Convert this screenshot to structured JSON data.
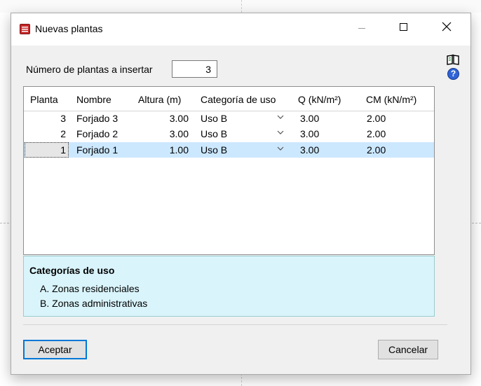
{
  "window": {
    "title": "Nuevas plantas",
    "icons": {
      "app": "app-logo-icon",
      "minimize": "minimize-icon",
      "maximize": "maximize-icon",
      "close": "close-icon"
    }
  },
  "side_icons": {
    "book": "book-icon",
    "help": "help-icon",
    "help_glyph": "?"
  },
  "form": {
    "count_label": "Número de plantas a insertar",
    "count_value": "3"
  },
  "table": {
    "columns": [
      "Planta",
      "Nombre",
      "Altura (m)",
      "Categoría de uso",
      "Q (kN/m²)",
      "CM (kN/m²)"
    ],
    "rows": [
      {
        "planta": "3",
        "nombre": "Forjado 3",
        "altura": "3.00",
        "categoria": "Uso B",
        "q": "3.00",
        "cm": "2.00",
        "selected": false
      },
      {
        "planta": "2",
        "nombre": "Forjado 2",
        "altura": "3.00",
        "categoria": "Uso B",
        "q": "3.00",
        "cm": "2.00",
        "selected": false
      },
      {
        "planta": "1",
        "nombre": "Forjado 1",
        "altura": "1.00",
        "categoria": "Uso B",
        "q": "3.00",
        "cm": "2.00",
        "selected": true
      }
    ]
  },
  "info": {
    "title": "Categorías de uso",
    "items": [
      "A. Zonas residenciales",
      "B. Zonas administrativas"
    ]
  },
  "buttons": {
    "ok": "Aceptar",
    "cancel": "Cancelar"
  },
  "colors": {
    "selection": "#cce8ff",
    "info_background": "#d9f4fb",
    "default_button_border": "#0078d7"
  }
}
